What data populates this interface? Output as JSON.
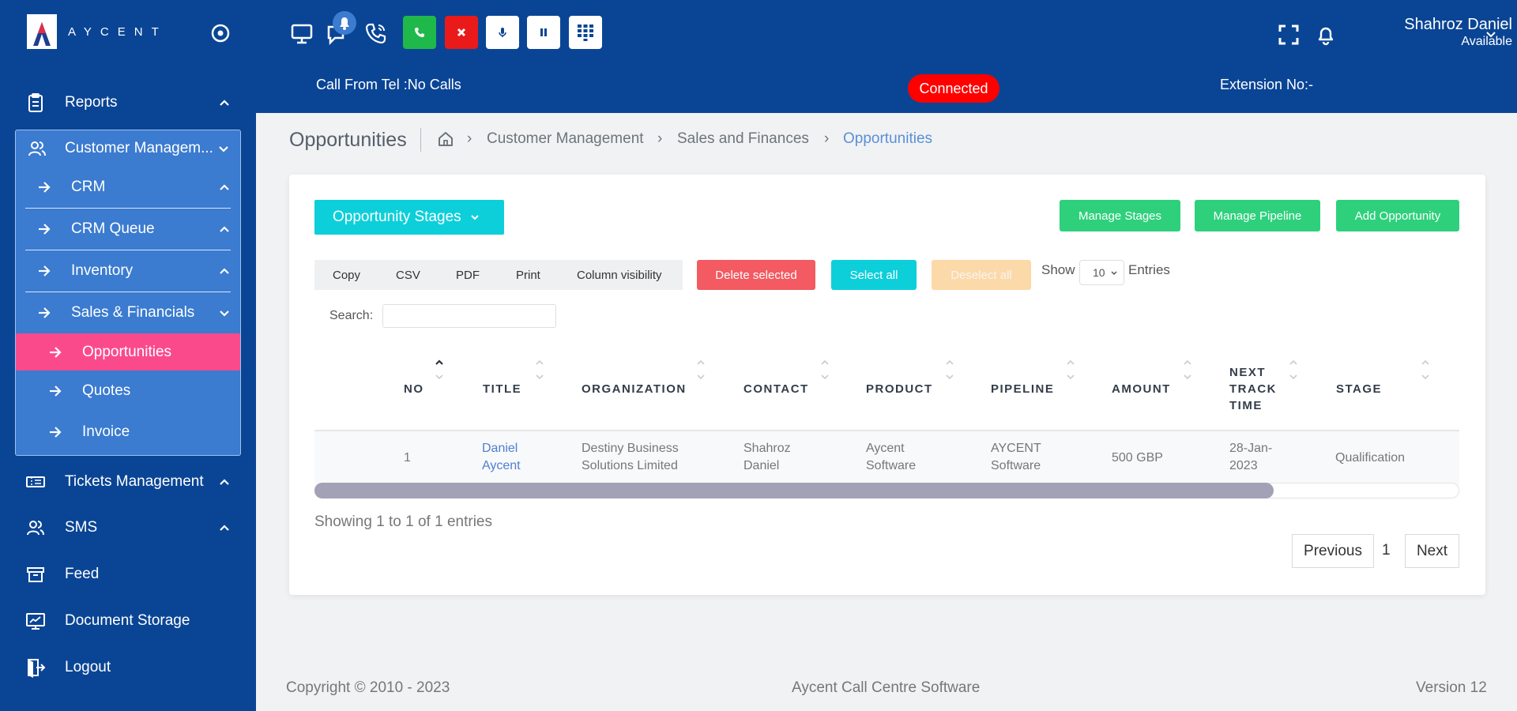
{
  "brand": {
    "name": "AYCENT"
  },
  "sidebar": {
    "items": [
      {
        "label": "Reports",
        "icon": "clipboard-icon"
      },
      {
        "label": "Customer Managem...",
        "icon": "users-icon"
      },
      {
        "label": "Tickets Management",
        "icon": "ticket-icon"
      },
      {
        "label": "SMS",
        "icon": "users-icon"
      },
      {
        "label": "Feed",
        "icon": "archive-icon"
      },
      {
        "label": "Document Storage",
        "icon": "monitor-chart-icon"
      },
      {
        "label": "Logout",
        "icon": "logout-icon"
      }
    ],
    "submenu": [
      {
        "label": "CRM"
      },
      {
        "label": "CRM Queue"
      },
      {
        "label": "Inventory"
      },
      {
        "label": "Sales & Financials"
      }
    ],
    "subsubmenu": [
      {
        "label": "Opportunities",
        "active": true
      },
      {
        "label": "Quotes"
      },
      {
        "label": "Invoice"
      }
    ]
  },
  "topbar": {
    "call_from": "Call From Tel :No Calls",
    "status": "Connected",
    "extension": "Extension No:-",
    "user_name": "Shahroz Daniel",
    "user_status": "Available",
    "colors": {
      "green": "#1fb84a",
      "red": "#ea1a1a",
      "status": "#ff0000"
    }
  },
  "breadcrumb": {
    "title": "Opportunities",
    "items": [
      "Customer Management",
      "Sales and Finances",
      "Opportunities"
    ]
  },
  "toolbar": {
    "stages_label": "Opportunity Stages",
    "manage_stages": "Manage Stages",
    "manage_pipeline": "Manage Pipeline",
    "add_opportunity": "Add Opportunity",
    "export_buttons": [
      "Copy",
      "CSV",
      "PDF",
      "Print",
      "Column visibility"
    ],
    "delete_selected": "Delete selected",
    "select_all": "Select all",
    "deselect_all": "Deselect all",
    "show_label": "Show",
    "page_size": "10",
    "entries_label": "Entries",
    "search_label": "Search:",
    "search_value": ""
  },
  "table": {
    "columns": [
      "NO",
      "TITLE",
      "ORGANIZATION",
      "CONTACT",
      "PRODUCT",
      "PIPELINE",
      "AMOUNT",
      "NEXT TRACK TIME",
      "STAGE"
    ],
    "rows": [
      {
        "no": "1",
        "title": "Daniel Aycent",
        "organization": "Destiny Business Solutions Limited",
        "contact": "Shahroz Daniel",
        "product": "Aycent Software",
        "pipeline": "AYCENT Software",
        "amount": "500 GBP",
        "next_track_time": "28-Jan-2023",
        "stage": "Qualification"
      }
    ],
    "showing": "Showing 1 to 1 of 1 entries"
  },
  "pagination": {
    "previous": "Previous",
    "current": "1",
    "next": "Next"
  },
  "footer": {
    "copyright": "Copyright © 2010 - 2023",
    "product": "Aycent Call Centre Software",
    "version": "Version 12"
  }
}
